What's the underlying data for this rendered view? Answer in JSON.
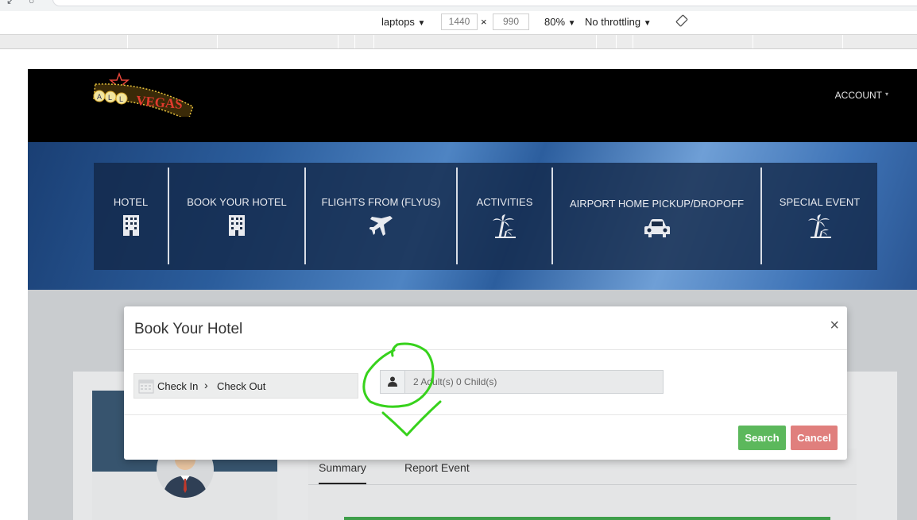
{
  "devtools": {
    "device": "laptops",
    "width": "1440",
    "times": "×",
    "height": "990",
    "zoom": "80%",
    "throttling": "No throttling",
    "caret": "▼",
    "rotate_icon": "rotate-icon"
  },
  "header": {
    "logo_text": "ALL VEGAS",
    "account": "ACCOUNT"
  },
  "nav": {
    "items": [
      {
        "label": "HOTEL",
        "icon": "building-icon"
      },
      {
        "label": "BOOK YOUR HOTEL",
        "icon": "building-icon"
      },
      {
        "label": "FLIGHTS FROM (FLYUS)",
        "icon": "plane-icon"
      },
      {
        "label": "ACTIVITIES",
        "icon": "palm-tree-icon"
      },
      {
        "label": "AIRPORT HOME PICKUP/DROPOFF",
        "icon": "car-icon"
      },
      {
        "label": "SPECIAL EVENT",
        "icon": "palm-tree-icon"
      }
    ]
  },
  "tabs": {
    "summary": "Summary",
    "report_event": "Report Event"
  },
  "modal": {
    "title": "Book Your Hotel",
    "close": "×",
    "check_in": "Check In",
    "arrow": "›",
    "check_out": "Check Out",
    "guests_value": "2 Adult(s) 0 Child(s)",
    "search": "Search",
    "cancel": "Cancel"
  },
  "colors": {
    "search_button": "#5cb85c",
    "cancel_button": "#e07f7d",
    "annotation": "#37d21c"
  }
}
